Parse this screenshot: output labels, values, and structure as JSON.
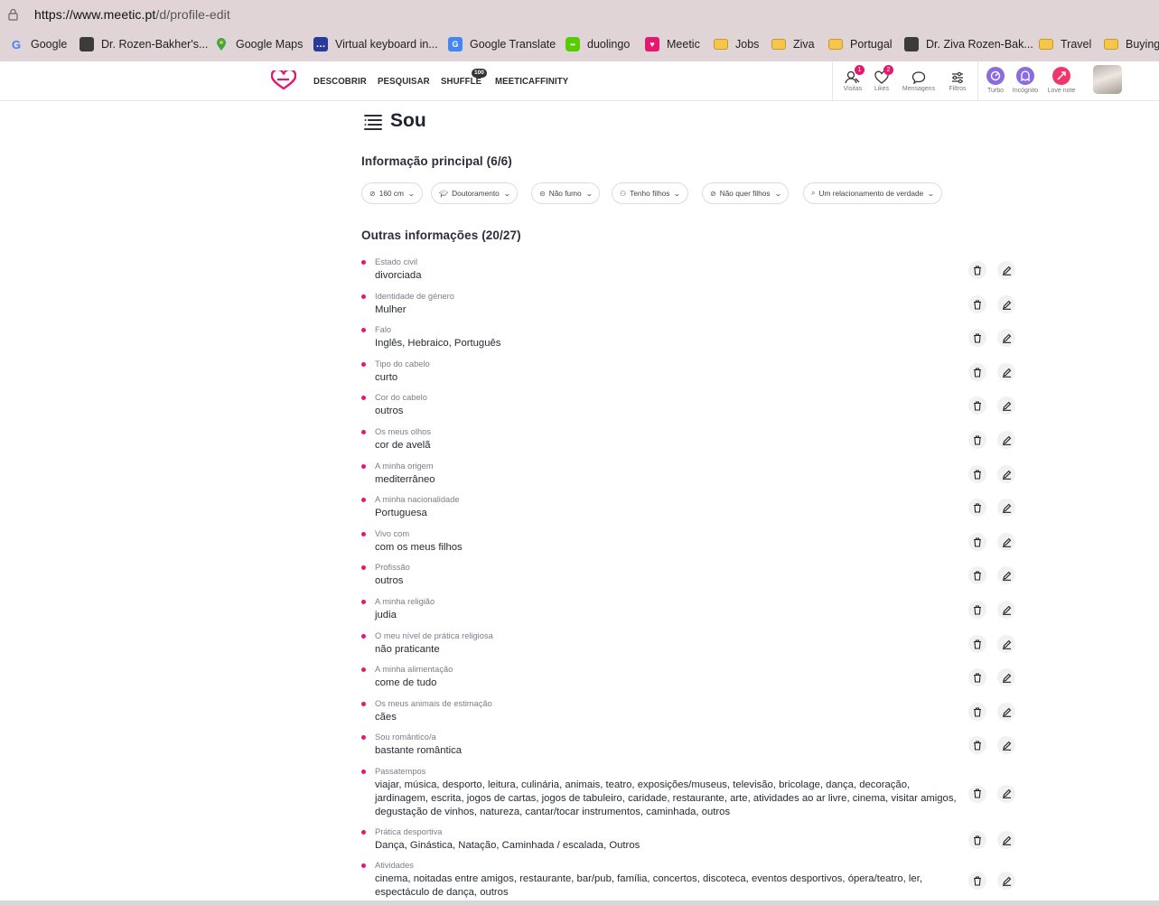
{
  "browser": {
    "url_scheme_host": "https://www.meetic.pt",
    "url_path": "/d/profile-edit",
    "bookmarks": [
      {
        "label": "Google",
        "icon": "google-icon"
      },
      {
        "label": "Dr. Rozen-Bakher's...",
        "icon": "cube-icon"
      },
      {
        "label": "Google Maps",
        "icon": "maps-pin-icon"
      },
      {
        "label": "Virtual keyboard in...",
        "icon": "chat-icon"
      },
      {
        "label": "Google Translate",
        "icon": "translate-icon"
      },
      {
        "label": "duolingo",
        "icon": "duolingo-icon"
      },
      {
        "label": "Meetic",
        "icon": "meetic-icon"
      },
      {
        "label": "Jobs",
        "icon": "folder-icon"
      },
      {
        "label": "Ziva",
        "icon": "folder-icon"
      },
      {
        "label": "Portugal",
        "icon": "folder-icon"
      },
      {
        "label": "Dr. Ziva Rozen-Bak...",
        "icon": "cube-icon"
      },
      {
        "label": "Travel",
        "icon": "folder-icon"
      },
      {
        "label": "Buying",
        "icon": "folder-icon"
      }
    ]
  },
  "nav": {
    "items": [
      "DESCOBRIR",
      "PESQUISAR",
      "SHUFFLE",
      "MEETICAFFINITY"
    ],
    "shuffle_badge": "100",
    "right": [
      {
        "label": "Visitas",
        "badge": "1"
      },
      {
        "label": "Likes",
        "badge": "2"
      },
      {
        "label": "Mensagens",
        "badge": ""
      },
      {
        "label": "Filtros",
        "badge": ""
      }
    ],
    "extras": [
      {
        "label": "Turbo",
        "color": "#8b6be0"
      },
      {
        "label": "Incógnito",
        "color": "#8b6be0"
      },
      {
        "label": "Love note",
        "color": "#f0366d"
      }
    ]
  },
  "page": {
    "title": "Sou",
    "main_info_title": "Informação principal (6/6)",
    "chips": [
      {
        "label": "160 cm",
        "icon": "ruler-icon"
      },
      {
        "label": "Doutoramento",
        "icon": "graduation-cap-icon"
      },
      {
        "label": "Não fumo",
        "icon": "no-smoking-icon"
      },
      {
        "label": "Tenho filhos",
        "icon": "family-icon"
      },
      {
        "label": "Não quer filhos",
        "icon": "pacifier-icon"
      },
      {
        "label": "Um relacionamento de verdade",
        "icon": "search-icon"
      }
    ],
    "other_info_title": "Outras informações (20/27)",
    "rows": [
      {
        "label": "Estado civil",
        "value": "divorciada"
      },
      {
        "label": "Identidade de género",
        "value": "Mulher"
      },
      {
        "label": "Falo",
        "value": "Inglês, Hebraico, Português"
      },
      {
        "label": "Tipo do cabelo",
        "value": "curto"
      },
      {
        "label": "Cor do cabelo",
        "value": "outros"
      },
      {
        "label": "Os meus olhos",
        "value": "cor de avelã"
      },
      {
        "label": "A minha origem",
        "value": "mediterrâneo"
      },
      {
        "label": "A minha nacionalidade",
        "value": "Portuguesa"
      },
      {
        "label": "Vivo com",
        "value": "com os meus filhos"
      },
      {
        "label": "Profissão",
        "value": "outros"
      },
      {
        "label": "A minha religião",
        "value": "judia"
      },
      {
        "label": "O meu nível de prática religiosa",
        "value": "não praticante"
      },
      {
        "label": "A minha alimentação",
        "value": "come de tudo"
      },
      {
        "label": "Os meus animais de estimação",
        "value": "cães"
      },
      {
        "label": "Sou romântico/a",
        "value": "bastante romântica"
      },
      {
        "label": "Passatempos",
        "value": "viajar, música, desporto, leitura, culinária, animais, teatro, exposições/museus, televisão, bricolage, dança, decoração, jardinagem, escrita, jogos de cartas, jogos de tabuleiro, caridade, restaurante, arte, atividades ao ar livre, cinema, visitar amigos, degustação de vinhos, natureza, cantar/tocar instrumentos, caminhada, outros"
      },
      {
        "label": "Prática desportiva",
        "value": "Dança, Ginástica, Natação, Caminhada / escalada, Outros"
      },
      {
        "label": "Atividades",
        "value": "cinema, noitadas entre amigos, restaurante, bar/pub, família, concertos, discoteca, eventos desportivos, ópera/teatro, ler, espectáculo de dança, outros"
      }
    ]
  },
  "colors": {
    "accent": "#e5186e",
    "browser_chrome": "#e0d4d7"
  }
}
